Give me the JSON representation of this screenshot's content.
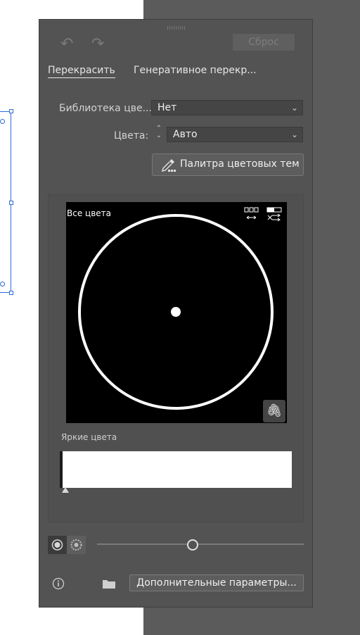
{
  "toolbar": {
    "reset_label": "Сброс"
  },
  "tabs": {
    "recolor": "Перекрасить",
    "generative": "Генеративное перекр..."
  },
  "library": {
    "label": "Библиотека цве...",
    "value": "Нет"
  },
  "colors": {
    "label": "Цвета:",
    "value": "Авто"
  },
  "theme_picker": {
    "label": "Палитра цветовых тем"
  },
  "wheel": {
    "label": "Все цвета",
    "background": "#000000",
    "ring_color": "#ffffff"
  },
  "bright_colors": {
    "label": "Яркие цвета",
    "swatch_color": "#ffffff"
  },
  "footer": {
    "more_label": "Дополнительные параметры..."
  },
  "icons": {
    "undo": "undo-icon",
    "redo": "redo-icon",
    "eyedropper": "eyedropper-icon",
    "link": "link-icon",
    "info": "info-icon",
    "folder": "folder-icon"
  }
}
